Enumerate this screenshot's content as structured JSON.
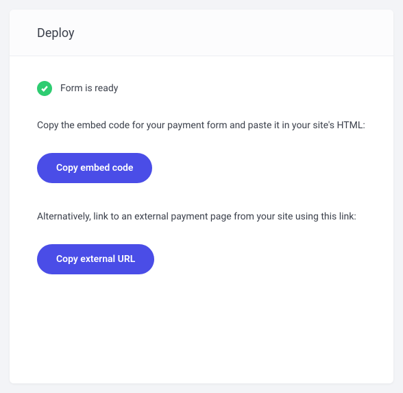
{
  "header": {
    "title": "Deploy"
  },
  "status": {
    "label": "Form is ready"
  },
  "embed": {
    "description": "Copy the embed code for your payment form and paste it in your site's HTML:",
    "button_label": "Copy embed code"
  },
  "external": {
    "description": "Alternatively, link to an external payment page from your site using this link:",
    "button_label": "Copy external URL"
  }
}
